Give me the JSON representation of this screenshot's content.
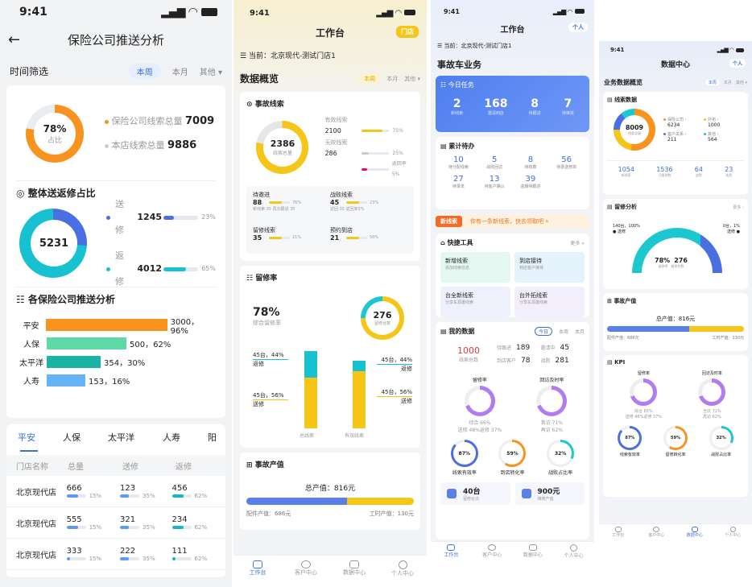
{
  "p1": {
    "time": "9:41",
    "title": "保险公司推送分析",
    "filter": {
      "label": "时间筛选",
      "opts": [
        "本周",
        "本月",
        "其他 ▾"
      ]
    },
    "summary": {
      "pct": "78%",
      "pct_label": "占比",
      "items": [
        {
          "label": "保险公司线索总量",
          "value": "7009",
          "color": "#f7931e"
        },
        {
          "label": "本店线索总量",
          "value": "9886",
          "color": "#cccccc"
        }
      ],
      "fill": 0.78
    },
    "overall": {
      "title": "整体送返修占比",
      "center": "5231",
      "items": [
        {
          "label": "送修",
          "value": "1245",
          "pct": "23%",
          "color": "#4a6fe3",
          "frac": 0.23
        },
        {
          "label": "返修",
          "value": "4012",
          "pct": "65%",
          "color": "#17c1cf",
          "frac": 0.65
        }
      ]
    },
    "company": {
      "title": "各保险公司推送分析",
      "rows": [
        {
          "name": "平安",
          "val": "3000，96%",
          "frac": 0.96,
          "color": "#f7931e"
        },
        {
          "name": "人保",
          "val": "500，62%",
          "frac": 0.62,
          "color": "#5fd9a5"
        },
        {
          "name": "太平洋",
          "val": "354，30%",
          "frac": 0.42,
          "color": "#1ab4a4"
        },
        {
          "name": "人寿",
          "val": "153，16%",
          "frac": 0.3,
          "color": "#66b3f7"
        }
      ]
    },
    "tabs": [
      "平安",
      "人保",
      "太平洋",
      "人寿",
      "阳"
    ],
    "table": {
      "headers": [
        "门店名称",
        "总量",
        "送修",
        "返修"
      ],
      "rows": [
        {
          "name": "北京现代店",
          "c": [
            {
              "v": "666",
              "p": "15%",
              "f": 0.6
            },
            {
              "v": "123",
              "p": "35%",
              "f": 0.45
            },
            {
              "v": "456",
              "p": "62%",
              "f": 0.62
            }
          ]
        },
        {
          "name": "北京现代店",
          "c": [
            {
              "v": "555",
              "p": "15%",
              "f": 0.6
            },
            {
              "v": "321",
              "p": "35%",
              "f": 0.45
            },
            {
              "v": "234",
              "p": "62%",
              "f": 0.62
            }
          ]
        },
        {
          "name": "北京现代店",
          "c": [
            {
              "v": "333",
              "p": "15%",
              "f": 0.2
            },
            {
              "v": "222",
              "p": "35%",
              "f": 0.45
            },
            {
              "v": "111",
              "p": "62%",
              "f": 0.2
            }
          ]
        }
      ]
    }
  },
  "p2": {
    "time": "9:41",
    "title": "工作台",
    "badge": "门店",
    "current": "当前：北京现代-测试门店1",
    "overview": "数据概览",
    "filter": [
      "本周",
      "本月",
      "其他 ▾"
    ],
    "clue": {
      "title": "事故线索",
      "total": "2386",
      "total_label": "线索总量",
      "fill": 0.78,
      "valid_label": "有效线索",
      "valid": "2100",
      "valid_pct": "75%",
      "invalid_label": "无效线索",
      "invalid": "286",
      "invalid_pct": "25%",
      "return_pct": "返回率5%",
      "cells": [
        {
          "t": "待邀进",
          "v": "88",
          "p": "76%",
          "sub": "新线索 35   再次跟进 35"
        },
        {
          "t": "战败线索",
          "v": "45",
          "p": "23%",
          "sub": "返回 35   返回率5%"
        },
        {
          "t": "留修线索",
          "v": "35",
          "p": "21%",
          "sub": ""
        },
        {
          "t": "预约到店",
          "v": "21",
          "p": "56%",
          "sub": ""
        }
      ]
    },
    "retain": {
      "title": "留修率",
      "pct": "78%",
      "pct_label": "综合留修率",
      "ring": "276",
      "ring_label": "留修台数",
      "ann": [
        "45台，44%",
        "返修",
        "45台，56%",
        "送修",
        "45台，44%",
        "返修",
        "45台，56%",
        "送修"
      ],
      "xl": [
        "总线索",
        "有效线索"
      ]
    },
    "value": {
      "title": "事故产值",
      "total": "总产值：816元",
      "parts": "配件产值：686元",
      "labor": "工时产值：130元",
      "frac": 0.6
    },
    "tabs": [
      "工作台",
      "客户中心",
      "数据中心",
      "个人中心"
    ]
  },
  "p3": {
    "time": "9:41",
    "title": "工作台",
    "badge": "个人",
    "current": "当前：北京现代-测试门店1",
    "section": "事故车业务",
    "today": {
      "title": "今日任务",
      "items": [
        {
          "v": "2",
          "l": "新线索"
        },
        {
          "v": "168",
          "l": "邀请到店"
        },
        {
          "v": "8",
          "l": "待跟进"
        },
        {
          "v": "7",
          "l": "待审批"
        }
      ]
    },
    "pending": {
      "title": "累计待办",
      "items": [
        {
          "v": "10",
          "l": "待分配线索"
        },
        {
          "v": "5",
          "l": "战败回访"
        },
        {
          "v": "8",
          "l": "待核算"
        },
        {
          "v": "56",
          "l": "待录送修单"
        },
        {
          "v": "27",
          "l": "待录单"
        },
        {
          "v": "13",
          "l": "待客户确认"
        },
        {
          "v": "39",
          "l": "逾期待跟进"
        }
      ]
    },
    "banner": {
      "tag": "新线索",
      "text": "你有一条新线索，快去领取吧 »"
    },
    "tools": {
      "title": "快捷工具",
      "more": "更多 »",
      "items": [
        {
          "t": "新增线索",
          "s": "添加线索信息"
        },
        {
          "t": "到店接待",
          "s": "到店客户接待"
        },
        {
          "t": "台全新线索",
          "s": "分享车源邀线索"
        },
        {
          "t": "台外拓线索",
          "s": "分享车源邀线索"
        }
      ]
    },
    "mydata": {
      "title": "我的数据",
      "tabs": [
        "今日",
        "本周",
        "本月"
      ],
      "big": "1000",
      "big_label": "线索总数",
      "stats": [
        {
          "l": "待跟进",
          "v": "189"
        },
        {
          "l": "邀请中",
          "v": "45"
        },
        {
          "l": "到店客户",
          "v": "78"
        },
        {
          "l": "战败",
          "v": "281"
        }
      ],
      "r1": [
        {
          "t": "留修率",
          "a": "综合 66%",
          "b": "送修 48%",
          "c": "返修 37%"
        },
        {
          "t": "回访及时率",
          "a": "首访 71%",
          "b": "再访 62%",
          "c": ""
        }
      ],
      "r2": [
        {
          "v": "87%",
          "l": "线索有效率"
        },
        {
          "v": "59%",
          "l": "到店转化率"
        },
        {
          "v": "32%",
          "l": "战败占比率"
        }
      ],
      "bottom": [
        {
          "v": "40台",
          "l": "留修台次"
        },
        {
          "v": "900元",
          "l": "维修产值"
        }
      ]
    },
    "tabs": [
      "工作台",
      "客户中心",
      "数据中心",
      "个人中心"
    ]
  },
  "p4": {
    "time": "9:41",
    "title": "数据中心",
    "badge": "个人",
    "section": "业务数据概览",
    "filter": [
      "本周",
      "本月",
      "其他 ▾"
    ],
    "clue": {
      "title": "线索数据",
      "center": "8009",
      "center_label": "线索总量",
      "legend": [
        {
          "l": "保险公司 ›",
          "v": "6234",
          "c": "#f7931e"
        },
        {
          "l": "外拓 ›",
          "v": "1000",
          "c": "#f5c518"
        },
        {
          "l": "客户关系 ›",
          "v": "211",
          "c": "#4a6fe3"
        },
        {
          "l": "其他 ›",
          "v": "564",
          "c": "#17c1cf"
        }
      ],
      "stats": [
        {
          "v": "1054",
          "l": "新线索"
        },
        {
          "v": "1536",
          "l": "已跟进数"
        },
        {
          "v": "64",
          "l": "战败"
        },
        {
          "v": "23",
          "l": "失败"
        }
      ]
    },
    "retain": {
      "title": "留修分析",
      "more": "更多 ›",
      "left": "140台，100%",
      "left2": "送修",
      "right": "0台，1%",
      "right2": "送修",
      "pct": "78%",
      "pct_label": "留修率",
      "num": "276",
      "num_label": "留修台数"
    },
    "value": {
      "title": "事故产值",
      "total": "总产值：816元",
      "parts": "配件产值：686元",
      "labor": "工时产值：130元"
    },
    "kpi": {
      "title": "KPI",
      "r1": [
        {
          "t": "留修率",
          "a": "综合 65%",
          "b": "送修 48%",
          "c": "返修 37%"
        },
        {
          "t": "回访及时率",
          "a": "当日 71%",
          "b": "再访 62%",
          "c": ""
        }
      ],
      "r2": [
        {
          "v": "87%",
          "l": "线索有效率"
        },
        {
          "v": "59%",
          "l": "留修转化率"
        },
        {
          "v": "32%",
          "l": "战败占比率"
        }
      ]
    },
    "tabs": [
      "工作台",
      "客户中心",
      "数据中心",
      "个人中心"
    ]
  }
}
